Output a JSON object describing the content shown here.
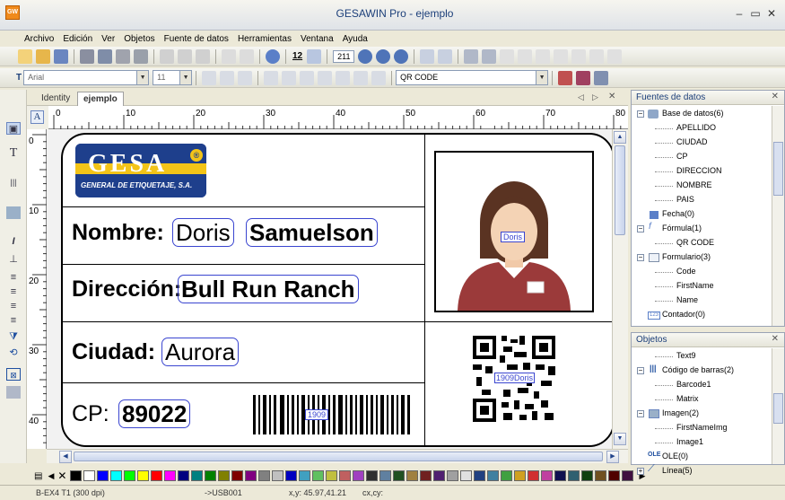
{
  "window": {
    "title": "GESAWIN Pro - ejemplo",
    "app_icon_text": "GW"
  },
  "menu": [
    "Archivo",
    "Edición",
    "Ver",
    "Objetos",
    "Fuente de datos",
    "Herramientas",
    "Ventana",
    "Ayuda"
  ],
  "toolbar": {
    "font_name": "Arial",
    "font_size": "11",
    "font_size_button": "12",
    "zoom_value": "211",
    "object_combo": "QR CODE"
  },
  "doc_tabs": [
    {
      "label": "Identity",
      "active": false
    },
    {
      "label": "ejemplo",
      "active": true
    }
  ],
  "ruler": {
    "h_ticks": [
      "0",
      "10",
      "20",
      "30",
      "40",
      "50",
      "60",
      "70",
      "80"
    ],
    "v_ticks": [
      "0",
      "10",
      "20",
      "30",
      "40"
    ]
  },
  "label": {
    "logo_text": "GESA",
    "logo_registered": "®",
    "logo_sub": "GENERAL DE ETIQUETAJE,  S.A.",
    "nombre_label": "Nombre:",
    "nombre_first": "Doris",
    "nombre_last": "Samuelson",
    "direccion_label": "Dirección:",
    "direccion_value": "Bull Run Ranch",
    "ciudad_label": "Ciudad:",
    "ciudad_value": "Aurora",
    "cp_label": "CP:",
    "cp_value": "89022",
    "barcode_text": "1909",
    "photo_caption": "Doris",
    "qr_caption": "1909Doris"
  },
  "palette": [
    "#000000",
    "#ffffff",
    "#0000ff",
    "#00ffff",
    "#00ff00",
    "#ffff00",
    "#ff0000",
    "#ff00ff",
    "#000080",
    "#008080",
    "#008000",
    "#808000",
    "#800000",
    "#800080",
    "#808080",
    "#c0c0c0",
    "#0000c0",
    "#40a0c0",
    "#60c060",
    "#c0c040",
    "#c06060",
    "#a040c0",
    "#303030",
    "#6080a0",
    "#205020",
    "#a08040",
    "#702020",
    "#502070",
    "#a0a0a0",
    "#e0e0e0",
    "#204080",
    "#4080a0",
    "#40a040",
    "#d0a020",
    "#d03030",
    "#c040a0",
    "#101050",
    "#306070",
    "#104010",
    "#705020",
    "#500000",
    "#401040"
  ],
  "status": {
    "printer": "B-EX4 T1 (300 dpi)",
    "port": "->USB001",
    "coords": "x,y: 45.97,41.21",
    "cxcy": "cx,cy:"
  },
  "fuentes": {
    "title": "Fuentes de datos",
    "base": "Base de datos(6)",
    "base_items": [
      "APELLIDO",
      "CIUDAD",
      "CP",
      "DIRECCION",
      "NOMBRE",
      "PAIS"
    ],
    "fecha": "Fecha(0)",
    "formula": "Fórmula(1)",
    "formula_items": [
      "QR CODE"
    ],
    "formulario": "Formulario(3)",
    "formulario_items": [
      "Code",
      "FirstName",
      "Name"
    ],
    "contador": "Contador(0)"
  },
  "objetos": {
    "title": "Objetos",
    "text9": "Text9",
    "codigo": "Código de barras(2)",
    "codigo_items": [
      "Barcode1",
      "Matrix"
    ],
    "imagen": "Imagen(2)",
    "imagen_items": [
      "FirstNameImg",
      "Image1"
    ],
    "ole": "OLE(0)",
    "linea": "Línea(5)"
  }
}
